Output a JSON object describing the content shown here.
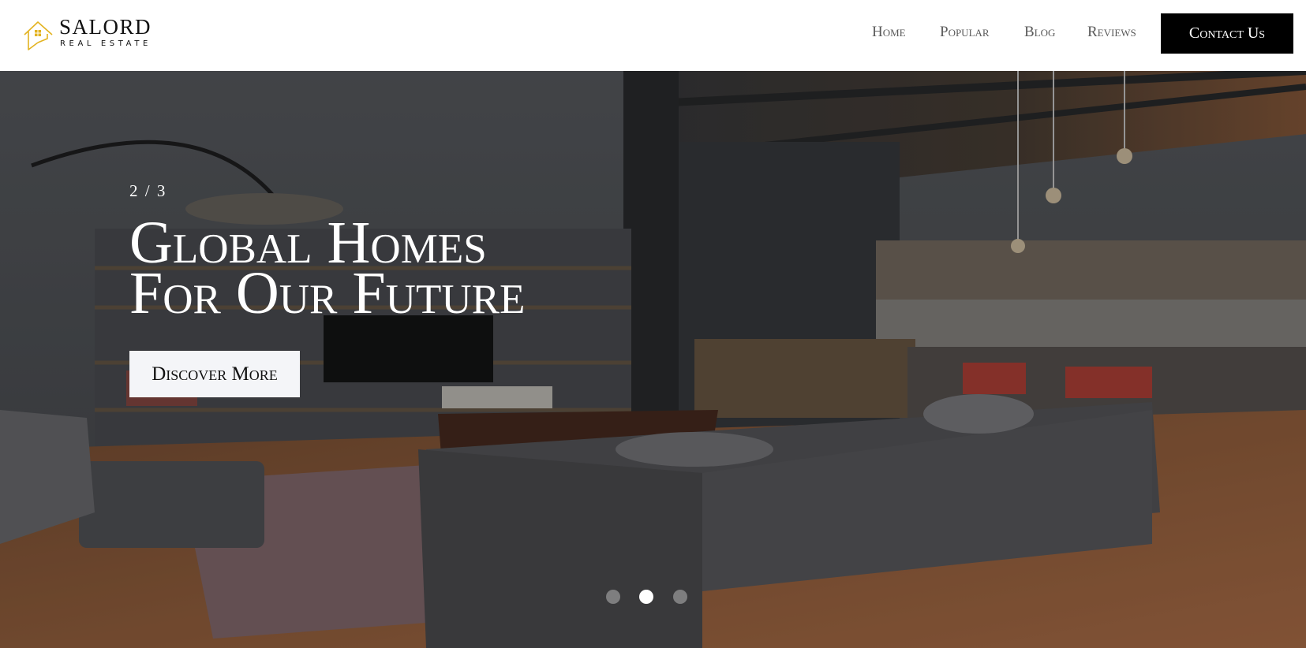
{
  "brand": {
    "name": "SALORD",
    "tagline": "REAL ESTATE",
    "accent_color": "#e3b321",
    "icon": "house-logo-icon"
  },
  "nav": {
    "items": [
      {
        "label": "Home"
      },
      {
        "label": "Popular"
      },
      {
        "label": "Blog"
      },
      {
        "label": "Reviews"
      }
    ],
    "cta_label": "Contact Us"
  },
  "hero": {
    "counter": "2 / 3",
    "title_line1": "Global Homes",
    "title_line2": "For Our Future",
    "button_label": "Discover More",
    "slides_total": 3,
    "active_slide": 2
  }
}
